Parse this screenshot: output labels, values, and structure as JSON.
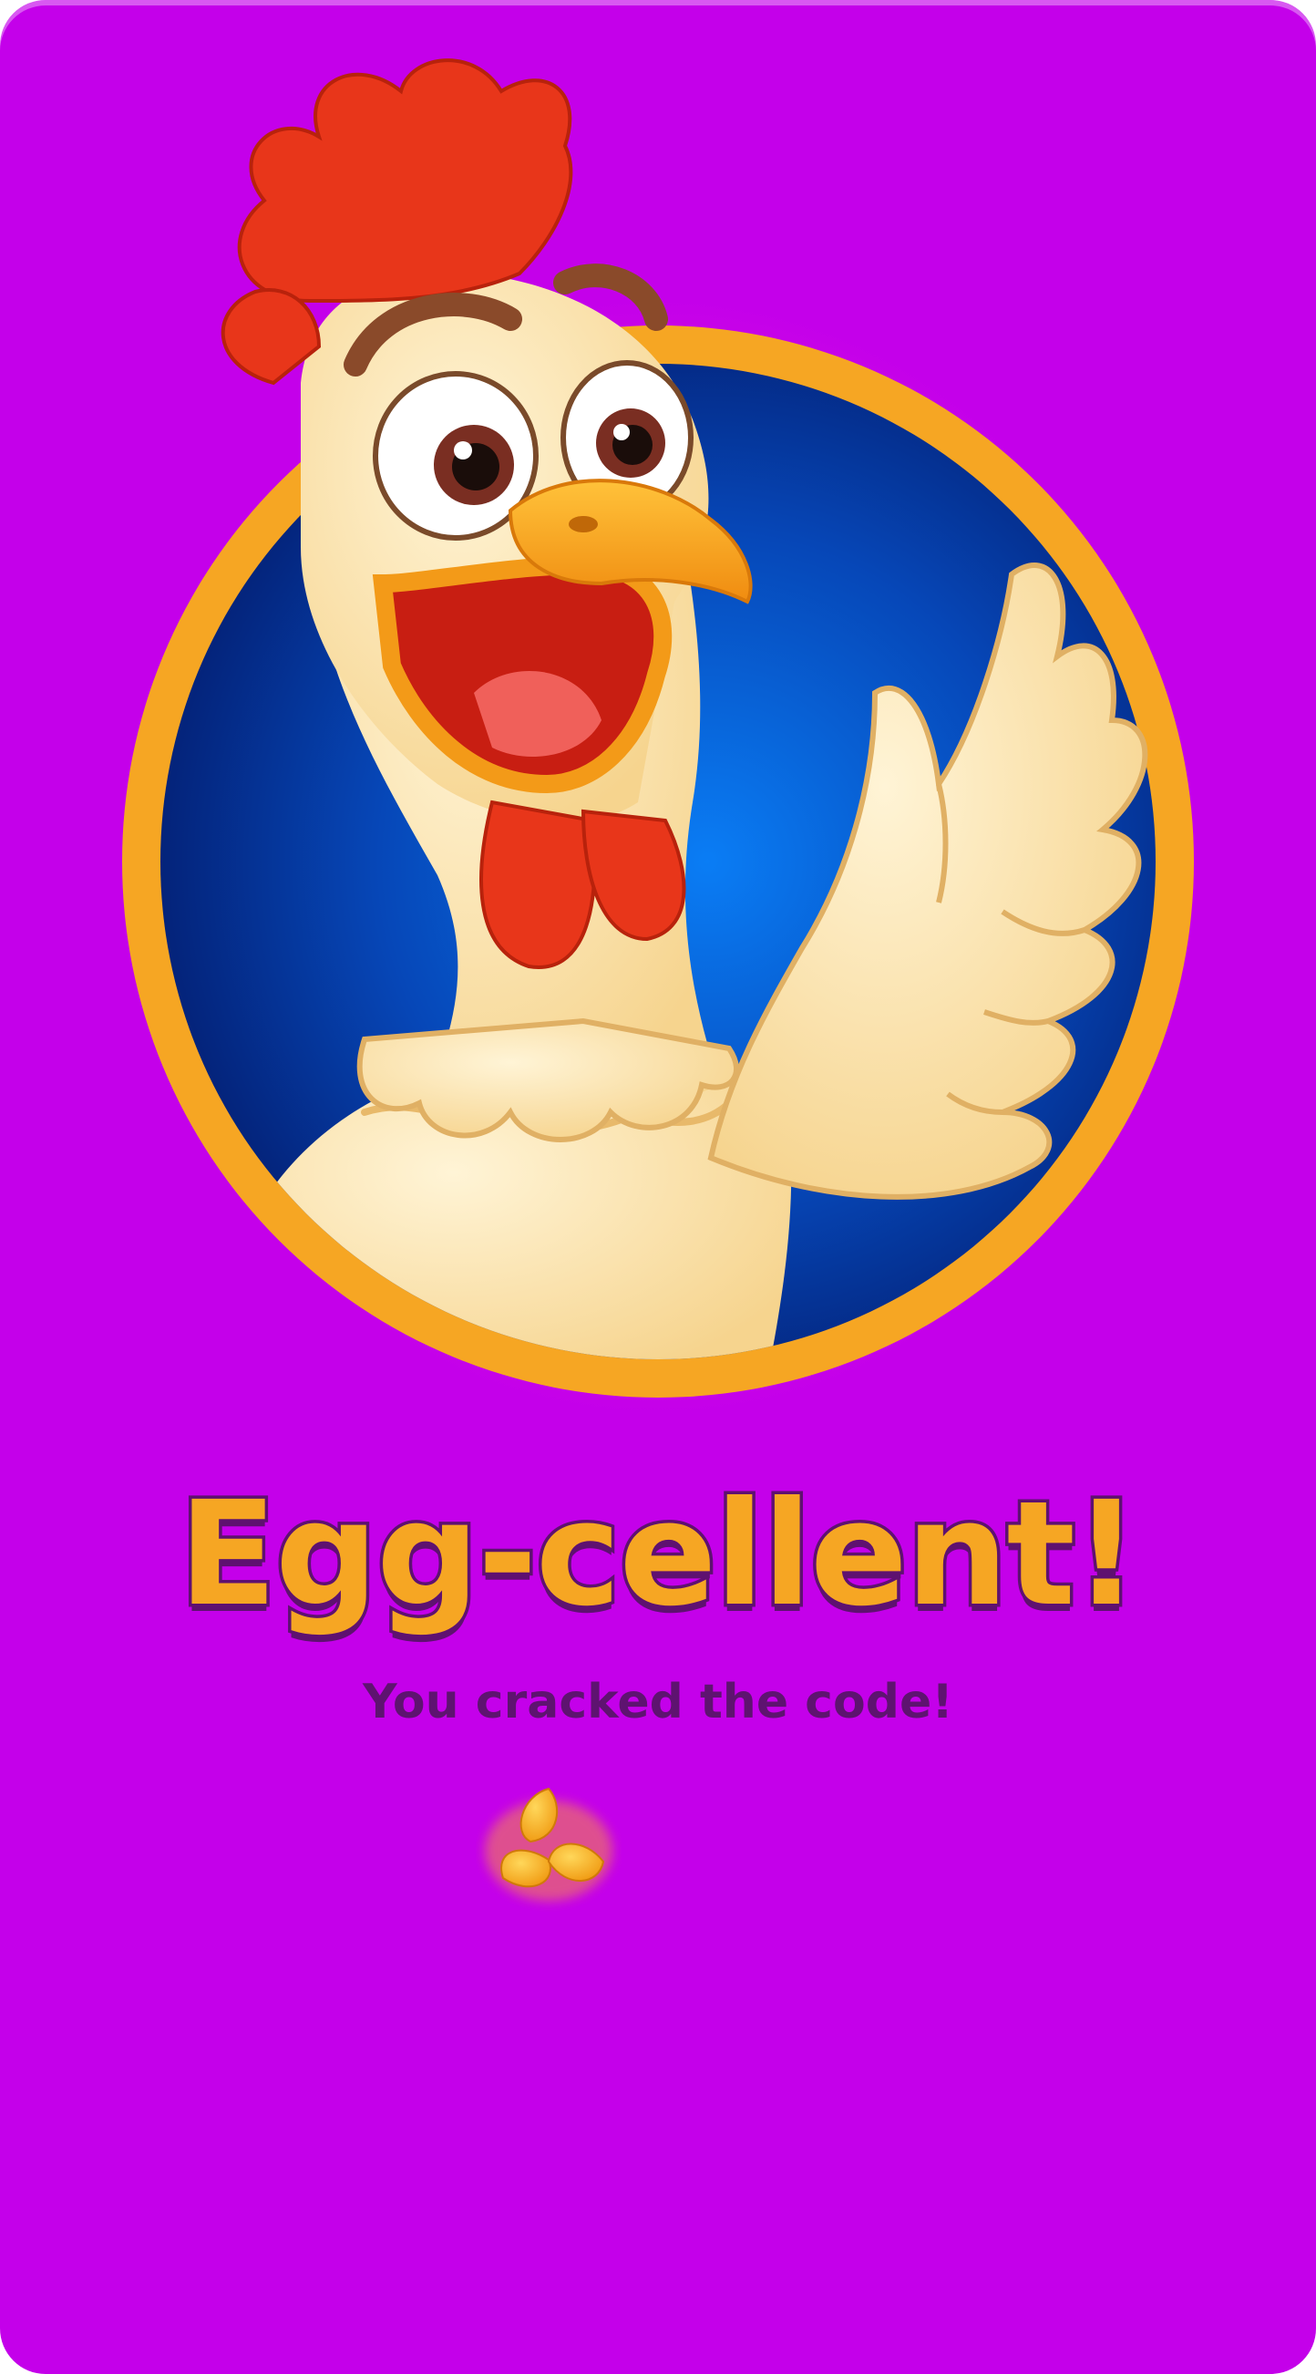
{
  "screen": {
    "background_color": "#c400ea",
    "accent_color": "#f6a623",
    "outline_color": "#5e1170"
  },
  "hero": {
    "icon": "rooster-mascot-icon",
    "frame_color": "#f6a623",
    "backdrop_color": "#0a4fd6"
  },
  "result": {
    "title": "Egg-cellent!",
    "subtitle": "You cracked the code!"
  },
  "reward": {
    "icon": "corn-seeds-icon"
  }
}
